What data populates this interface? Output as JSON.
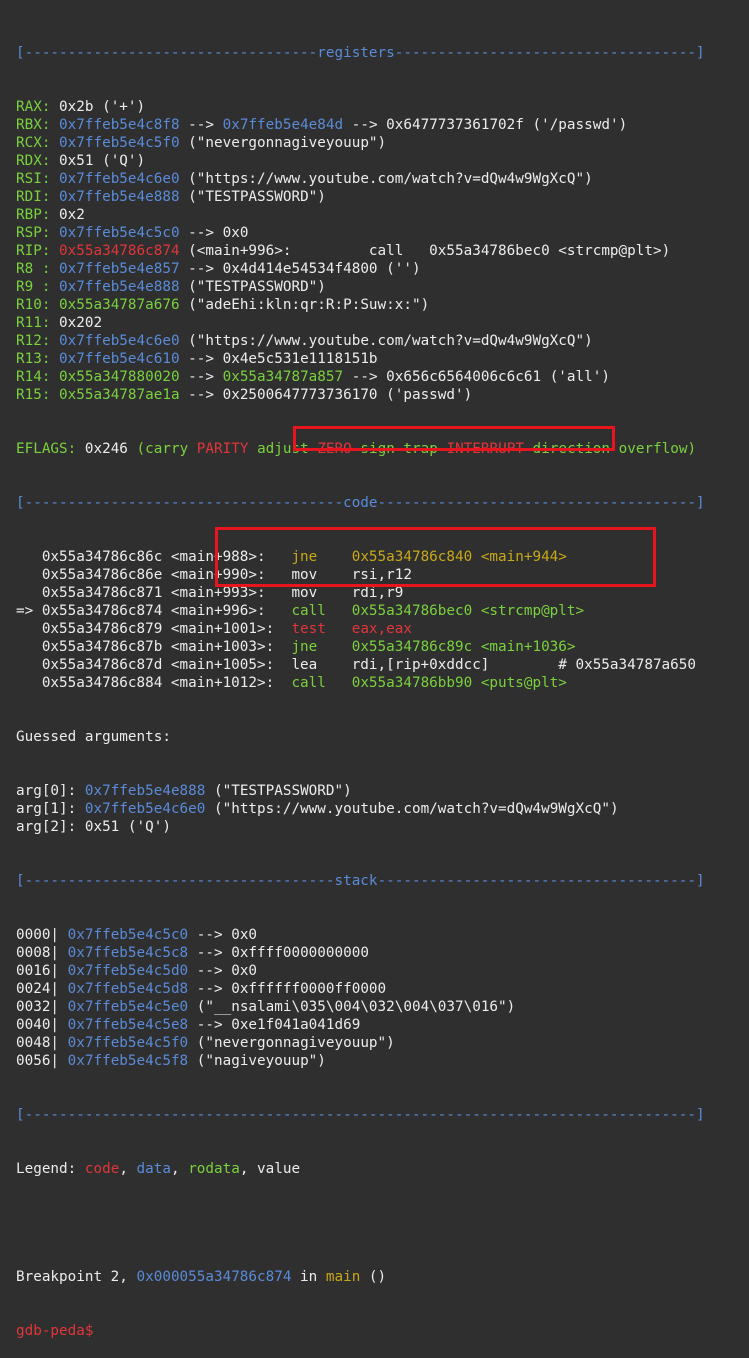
{
  "separators": {
    "registers": "[----------------------------------registers-----------------------------------]",
    "code": "[-------------------------------------code-------------------------------------]",
    "stack": "[------------------------------------stack-------------------------------------]",
    "end": "[------------------------------------------------------------------------------]"
  },
  "registers": [
    {
      "name": "RAX:",
      "parts": [
        {
          "t": " 0x2b ('+')",
          "c": ""
        }
      ]
    },
    {
      "name": "RBX:",
      "parts": [
        {
          "t": " ",
          "c": ""
        },
        {
          "t": "0x7ffeb5e4c8f8",
          "c": "b"
        },
        {
          "t": " --> ",
          "c": ""
        },
        {
          "t": "0x7ffeb5e4e84d",
          "c": "b"
        },
        {
          "t": " --> 0x6477737361702f ('/passwd')",
          "c": ""
        }
      ]
    },
    {
      "name": "RCX:",
      "parts": [
        {
          "t": " ",
          "c": ""
        },
        {
          "t": "0x7ffeb5e4c5f0",
          "c": "b"
        },
        {
          "t": " (\"nevergonnagiveyouup\")",
          "c": ""
        }
      ]
    },
    {
      "name": "RDX:",
      "parts": [
        {
          "t": " 0x51 ('Q')",
          "c": ""
        }
      ]
    },
    {
      "name": "RSI:",
      "parts": [
        {
          "t": " ",
          "c": ""
        },
        {
          "t": "0x7ffeb5e4c6e0",
          "c": "b"
        },
        {
          "t": " (\"https://www.youtube.com/watch?v=dQw4w9WgXcQ\")",
          "c": ""
        }
      ]
    },
    {
      "name": "RDI:",
      "parts": [
        {
          "t": " ",
          "c": ""
        },
        {
          "t": "0x7ffeb5e4e888",
          "c": "b"
        },
        {
          "t": " (\"TESTPASSWORD\")",
          "c": ""
        }
      ]
    },
    {
      "name": "RBP:",
      "parts": [
        {
          "t": " 0x2",
          "c": ""
        }
      ]
    },
    {
      "name": "RSP:",
      "parts": [
        {
          "t": " ",
          "c": ""
        },
        {
          "t": "0x7ffeb5e4c5c0",
          "c": "b"
        },
        {
          "t": " --> 0x0",
          "c": ""
        }
      ]
    },
    {
      "name": "RIP:",
      "parts": [
        {
          "t": " ",
          "c": ""
        },
        {
          "t": "0x55a34786c874",
          "c": "r"
        },
        {
          "t": " (<main+996>:         call   0x55a34786bec0 <strcmp@plt>)",
          "c": ""
        }
      ]
    },
    {
      "name": "R8 :",
      "parts": [
        {
          "t": " ",
          "c": ""
        },
        {
          "t": "0x7ffeb5e4e857",
          "c": "b"
        },
        {
          "t": " --> 0x4d414e54534f4800 ('')",
          "c": ""
        }
      ]
    },
    {
      "name": "R9 :",
      "parts": [
        {
          "t": " ",
          "c": ""
        },
        {
          "t": "0x7ffeb5e4e888",
          "c": "b"
        },
        {
          "t": " (\"TESTPASSWORD\")",
          "c": ""
        }
      ]
    },
    {
      "name": "R10:",
      "parts": [
        {
          "t": " ",
          "c": ""
        },
        {
          "t": "0x55a34787a676",
          "c": "g"
        },
        {
          "t": " (\"adeEhi:kln:qr:R:P:Suw:x:\")",
          "c": ""
        }
      ]
    },
    {
      "name": "R11:",
      "parts": [
        {
          "t": " 0x202",
          "c": ""
        }
      ]
    },
    {
      "name": "R12:",
      "parts": [
        {
          "t": " ",
          "c": ""
        },
        {
          "t": "0x7ffeb5e4c6e0",
          "c": "b"
        },
        {
          "t": " (\"https://www.youtube.com/watch?v=dQw4w9WgXcQ\")",
          "c": ""
        }
      ]
    },
    {
      "name": "R13:",
      "parts": [
        {
          "t": " ",
          "c": ""
        },
        {
          "t": "0x7ffeb5e4c610",
          "c": "b"
        },
        {
          "t": " --> 0x4e5c531e1118151b",
          "c": ""
        }
      ]
    },
    {
      "name": "R14:",
      "parts": [
        {
          "t": " ",
          "c": ""
        },
        {
          "t": "0x55a347880020",
          "c": "g"
        },
        {
          "t": " --> ",
          "c": ""
        },
        {
          "t": "0x55a34787a857",
          "c": "g"
        },
        {
          "t": " --> 0x656c6564006c6c61 ('all')",
          "c": ""
        }
      ]
    },
    {
      "name": "R15:",
      "parts": [
        {
          "t": " ",
          "c": ""
        },
        {
          "t": "0x55a34787ae1a",
          "c": "g"
        },
        {
          "t": " --> 0x2500647773736170 ('passwd')",
          "c": ""
        }
      ]
    }
  ],
  "eflags": {
    "name": "EFLAGS:",
    "parts": [
      {
        "t": " 0x246 ",
        "c": ""
      },
      {
        "t": "(",
        "c": "g"
      },
      {
        "t": "carry ",
        "c": "g"
      },
      {
        "t": "PARITY ",
        "c": "r"
      },
      {
        "t": "adjust ",
        "c": "g"
      },
      {
        "t": "ZERO ",
        "c": "r"
      },
      {
        "t": "sign ",
        "c": "g"
      },
      {
        "t": "trap ",
        "c": "g"
      },
      {
        "t": "INTERRUPT ",
        "c": "r"
      },
      {
        "t": "direction ",
        "c": "g"
      },
      {
        "t": "overflow",
        "c": "g"
      },
      {
        "t": ")",
        "c": "g"
      }
    ]
  },
  "code": [
    {
      "parts": [
        {
          "t": "   0x55a34786c86c <main+988>:   ",
          "c": ""
        },
        {
          "t": "jne    0x55a34786c840 <main+944>",
          "c": "y"
        }
      ]
    },
    {
      "parts": [
        {
          "t": "   0x55a34786c86e <main+990>:   mov    rsi,r12",
          "c": ""
        }
      ]
    },
    {
      "parts": [
        {
          "t": "   0x55a34786c871 <main+993>:   mov    rdi,r9",
          "c": ""
        }
      ]
    },
    {
      "parts": [
        {
          "t": "=> 0x55a34786c874 <main+996>:   ",
          "c": ""
        },
        {
          "t": "call   0x55a34786bec0 <strcmp@plt>",
          "c": "g"
        }
      ]
    },
    {
      "parts": [
        {
          "t": "   0x55a34786c879 <main+1001>:  ",
          "c": ""
        },
        {
          "t": "test   eax,eax",
          "c": "r"
        }
      ]
    },
    {
      "parts": [
        {
          "t": "   0x55a34786c87b <main+1003>:  ",
          "c": ""
        },
        {
          "t": "jne    0x55a34786c89c <main+1036>",
          "c": "g"
        }
      ]
    },
    {
      "parts": [
        {
          "t": "   0x55a34786c87d <main+1005>:  lea    rdi,[rip+0xddcc]        # 0x55a34787a650",
          "c": ""
        }
      ]
    },
    {
      "parts": [
        {
          "t": "   0x55a34786c884 <main+1012>:  ",
          "c": ""
        },
        {
          "t": "call   0x55a34786bb90 <puts@plt>",
          "c": "g"
        }
      ]
    }
  ],
  "guessed_header": "Guessed arguments:",
  "args": [
    {
      "parts": [
        {
          "t": "arg[0]: ",
          "c": ""
        },
        {
          "t": "0x7ffeb5e4e888",
          "c": "b"
        },
        {
          "t": " (\"TESTPASSWORD\")",
          "c": ""
        }
      ]
    },
    {
      "parts": [
        {
          "t": "arg[1]: ",
          "c": ""
        },
        {
          "t": "0x7ffeb5e4c6e0",
          "c": "b"
        },
        {
          "t": " (\"https://www.youtube.com/watch?v=dQw4w9WgXcQ\")",
          "c": ""
        }
      ]
    },
    {
      "parts": [
        {
          "t": "arg[2]: 0x51 ('Q')",
          "c": ""
        }
      ]
    }
  ],
  "stack": [
    {
      "parts": [
        {
          "t": "0000| ",
          "c": ""
        },
        {
          "t": "0x7ffeb5e4c5c0",
          "c": "b"
        },
        {
          "t": " --> 0x0",
          "c": ""
        }
      ]
    },
    {
      "parts": [
        {
          "t": "0008| ",
          "c": ""
        },
        {
          "t": "0x7ffeb5e4c5c8",
          "c": "b"
        },
        {
          "t": " --> 0xffff0000000000",
          "c": ""
        }
      ]
    },
    {
      "parts": [
        {
          "t": "0016| ",
          "c": ""
        },
        {
          "t": "0x7ffeb5e4c5d0",
          "c": "b"
        },
        {
          "t": " --> 0x0",
          "c": ""
        }
      ]
    },
    {
      "parts": [
        {
          "t": "0024| ",
          "c": ""
        },
        {
          "t": "0x7ffeb5e4c5d8",
          "c": "b"
        },
        {
          "t": " --> 0xffffff0000ff0000",
          "c": ""
        }
      ]
    },
    {
      "parts": [
        {
          "t": "0032| ",
          "c": ""
        },
        {
          "t": "0x7ffeb5e4c5e0",
          "c": "b"
        },
        {
          "t": " (\"__nsalami\\035\\004\\032\\004\\037\\016\")",
          "c": ""
        }
      ]
    },
    {
      "parts": [
        {
          "t": "0040| ",
          "c": ""
        },
        {
          "t": "0x7ffeb5e4c5e8",
          "c": "b"
        },
        {
          "t": " --> 0xe1f041a041d69",
          "c": ""
        }
      ]
    },
    {
      "parts": [
        {
          "t": "0048| ",
          "c": ""
        },
        {
          "t": "0x7ffeb5e4c5f0",
          "c": "b"
        },
        {
          "t": " (\"nevergonnagiveyouup\")",
          "c": ""
        }
      ]
    },
    {
      "parts": [
        {
          "t": "0056| ",
          "c": ""
        },
        {
          "t": "0x7ffeb5e4c5f8",
          "c": "b"
        },
        {
          "t": " (\"nagiveyouup\")",
          "c": ""
        }
      ]
    }
  ],
  "legend": {
    "parts": [
      {
        "t": "Legend: ",
        "c": ""
      },
      {
        "t": "code",
        "c": "r"
      },
      {
        "t": ", ",
        "c": ""
      },
      {
        "t": "data",
        "c": "b"
      },
      {
        "t": ", ",
        "c": ""
      },
      {
        "t": "rodata",
        "c": "g"
      },
      {
        "t": ", value",
        "c": ""
      }
    ]
  },
  "breakpoint": {
    "parts": [
      {
        "t": "Breakpoint 2, ",
        "c": ""
      },
      {
        "t": "0x000055a34786c874",
        "c": "b"
      },
      {
        "t": " in ",
        "c": ""
      },
      {
        "t": "main",
        "c": "y"
      },
      {
        "t": " ()",
        "c": ""
      }
    ]
  },
  "prompt": "gdb-peda$",
  "colors": {
    "background": "#2f2f2f",
    "text": "#ececec",
    "green": "#7ad13e",
    "blue": "#5a8bd8",
    "red": "#e0363a",
    "yellow": "#c8a818",
    "highlight_box": "#e8141e"
  }
}
